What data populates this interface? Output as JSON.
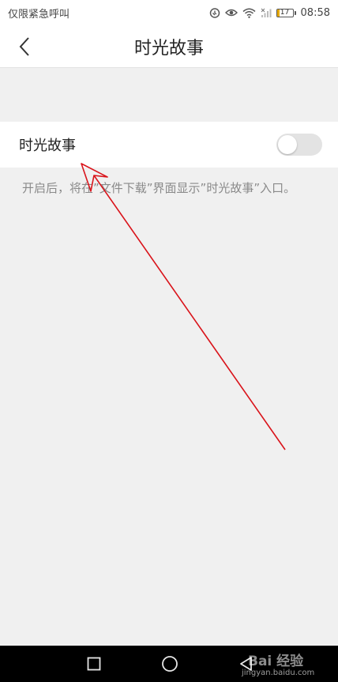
{
  "status_bar": {
    "carrier_text": "仅限紧急呼叫",
    "battery_level": "17",
    "time": "08:58",
    "icons": [
      "alarm-clock-icon",
      "eye-icon",
      "wifi-icon",
      "signal-icon",
      "battery-icon"
    ]
  },
  "header": {
    "title": "时光故事",
    "back_icon": "chevron-left-icon"
  },
  "settings": {
    "time_story": {
      "label": "时光故事",
      "enabled": false,
      "description": "开启后，将在”文件下载”界面显示”时光故事”入口。"
    }
  },
  "annotation": {
    "color": "#d9141b"
  },
  "nav_bar": {
    "icons": [
      "square-recent-icon",
      "circle-home-icon",
      "triangle-back-icon"
    ]
  },
  "watermark": {
    "text": "Bai 经验",
    "url": "jingyan.baidu.com"
  },
  "colors": {
    "background": "#f0f0f0",
    "surface": "#ffffff",
    "toggle_off": "#e3e3e3",
    "description_text": "#8a8a8a"
  }
}
